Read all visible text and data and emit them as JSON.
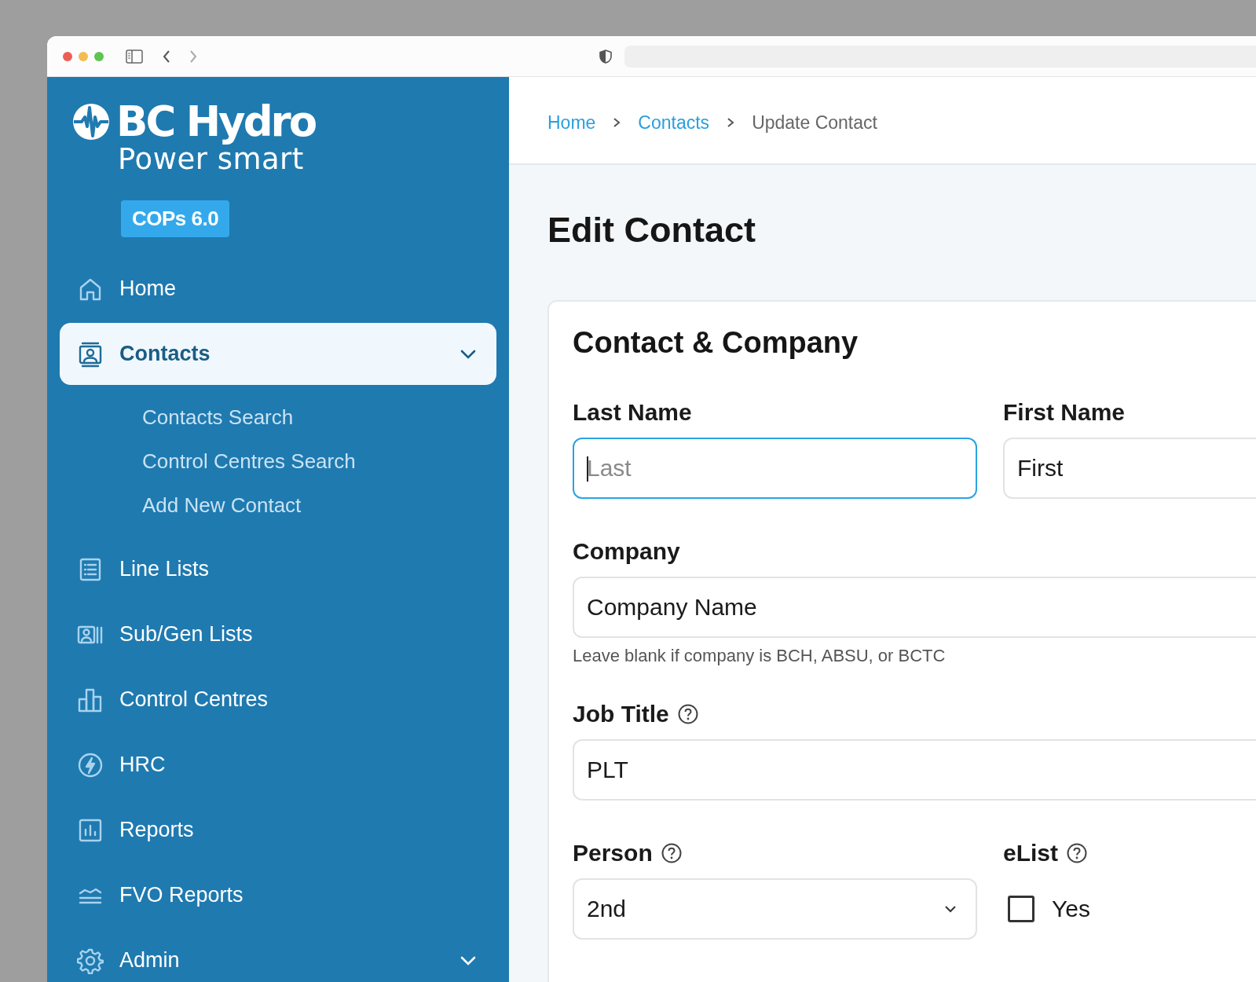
{
  "sidebar": {
    "logo": {
      "brand": "BC Hydro",
      "tagline": "Power smart"
    },
    "version_badge": "COPs 6.0",
    "items": [
      {
        "label": "Home",
        "selected": false,
        "expandable": false
      },
      {
        "label": "Contacts",
        "selected": true,
        "expandable": true,
        "expanded": true,
        "children": [
          {
            "label": "Contacts Search"
          },
          {
            "label": "Control Centres Search"
          },
          {
            "label": "Add New Contact"
          }
        ]
      },
      {
        "label": "Line Lists",
        "selected": false,
        "expandable": false
      },
      {
        "label": "Sub/Gen Lists",
        "selected": false,
        "expandable": false
      },
      {
        "label": "Control Centres",
        "selected": false,
        "expandable": false
      },
      {
        "label": "HRC",
        "selected": false,
        "expandable": false
      },
      {
        "label": "Reports",
        "selected": false,
        "expandable": false
      },
      {
        "label": "FVO Reports",
        "selected": false,
        "expandable": false
      },
      {
        "label": "Admin",
        "selected": false,
        "expandable": true,
        "expanded": false
      }
    ]
  },
  "breadcrumb": [
    {
      "label": "Home",
      "kind": "link"
    },
    {
      "label": "Contacts",
      "kind": "link"
    },
    {
      "label": "Update Contact",
      "kind": "current"
    }
  ],
  "page_title": "Edit Contact",
  "form": {
    "section_title": "Contact & Company",
    "rows": [
      [
        {
          "kind": "text",
          "label": "Last Name",
          "placeholder": "Last",
          "focused": true,
          "help": false
        },
        {
          "kind": "text",
          "label": "First Name",
          "value": "First",
          "focused": false,
          "help": false
        }
      ],
      [
        {
          "kind": "text",
          "label": "Company",
          "value": "Company Name",
          "hint": "Leave blank if company is BCH, ABSU, or BCTC",
          "focused": false,
          "help": false
        }
      ],
      [
        {
          "kind": "text",
          "label": "Job Title",
          "value": "PLT",
          "focused": false,
          "help": true
        }
      ],
      [
        {
          "kind": "select",
          "label": "Person",
          "value": "2nd",
          "focused": false,
          "help": true
        },
        {
          "kind": "checkbox",
          "label": "eList",
          "option": "Yes",
          "checked": false,
          "help": true
        }
      ]
    ]
  }
}
